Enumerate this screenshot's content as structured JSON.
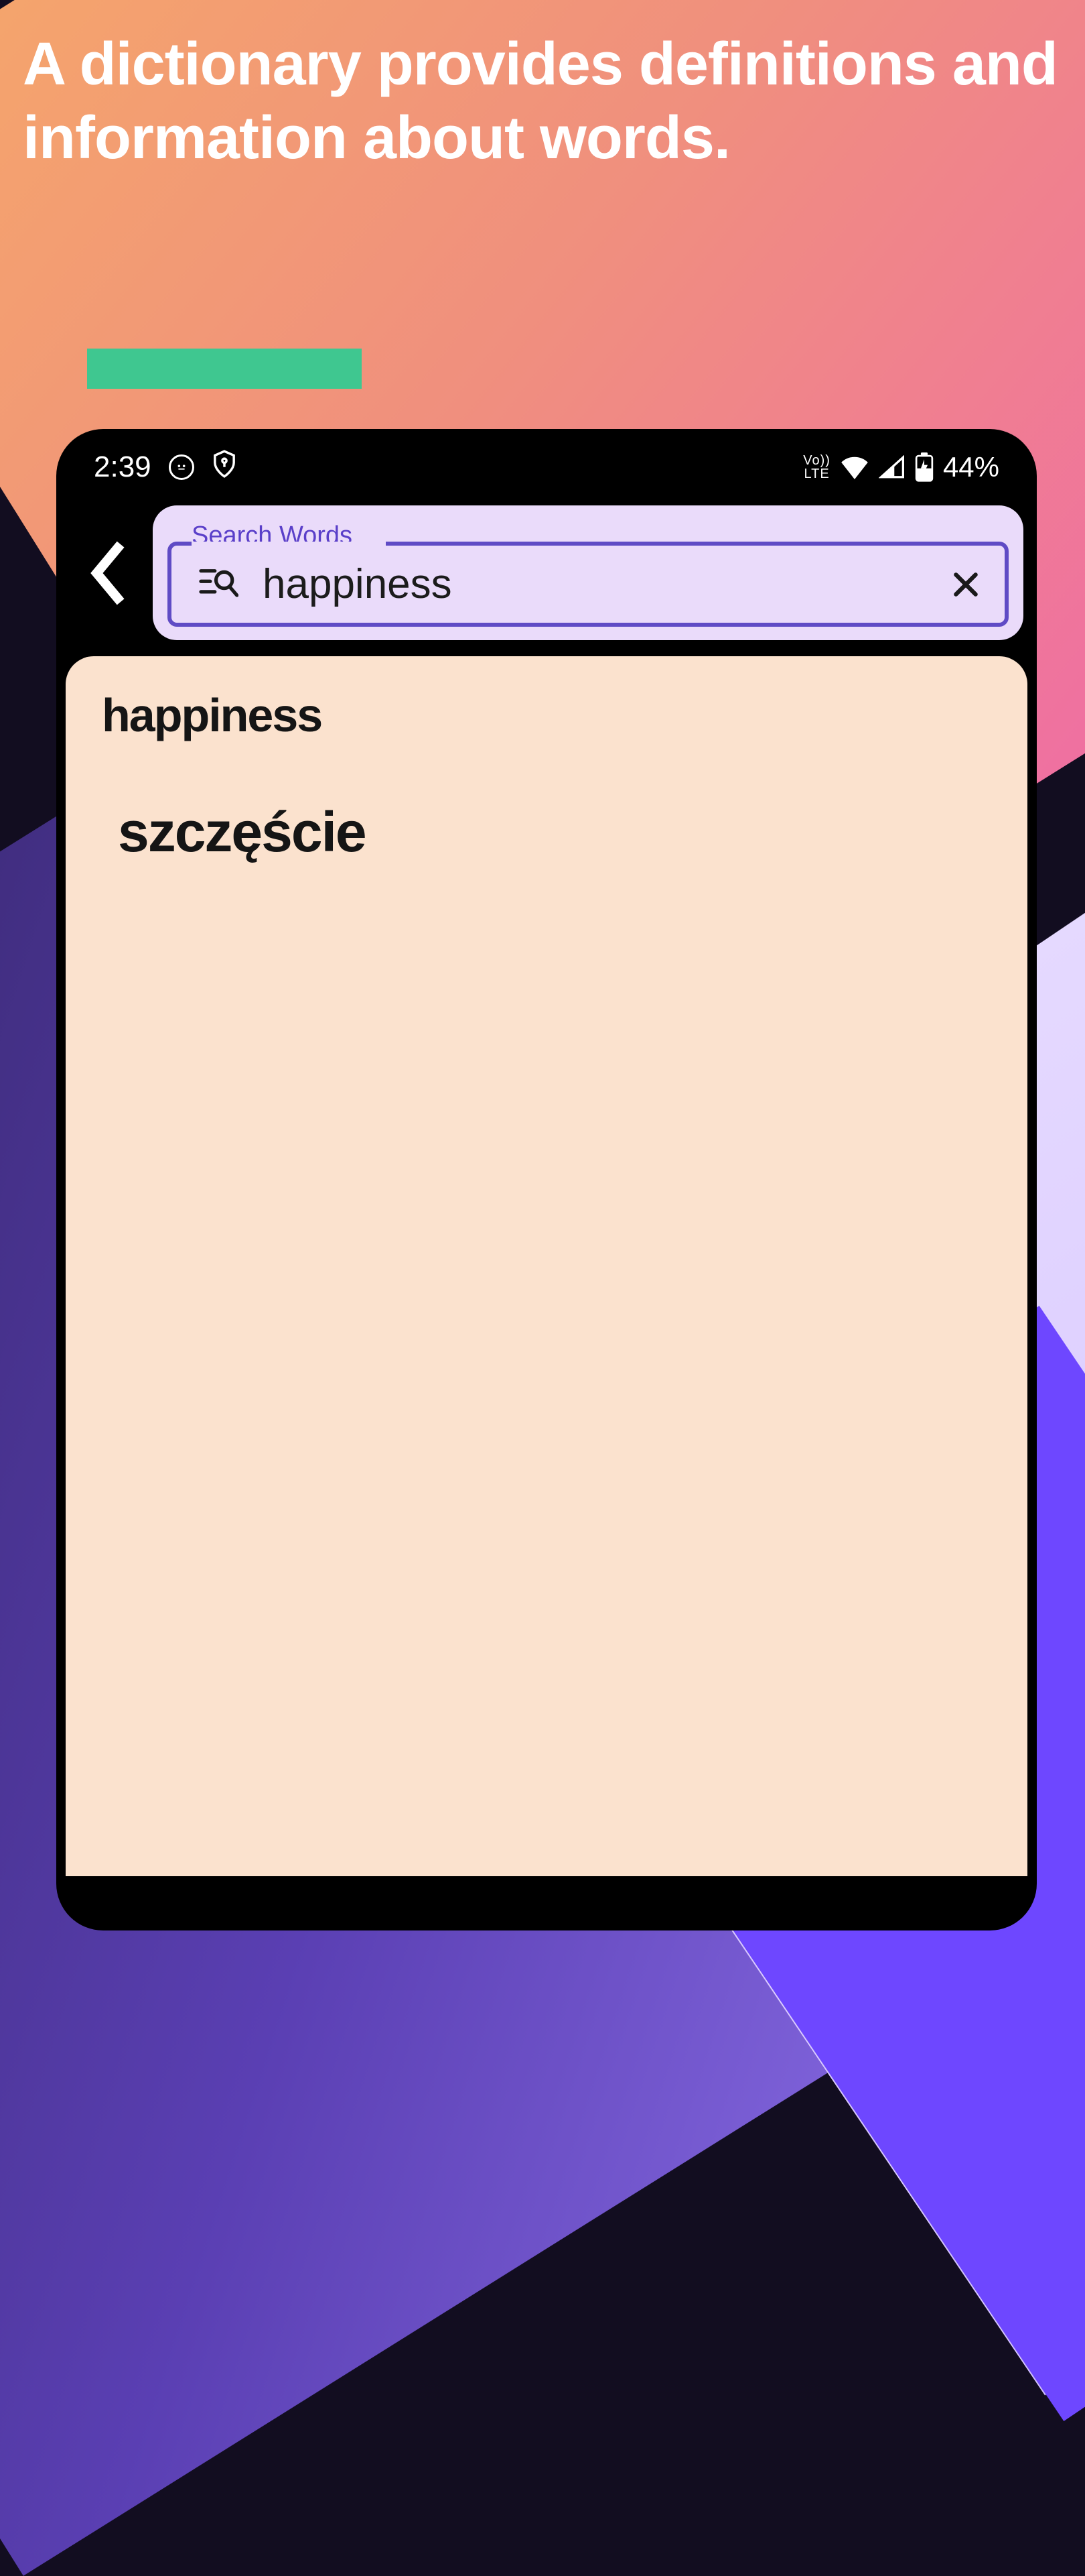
{
  "headline": "A dictionary provides definitions and information about words.",
  "statusbar": {
    "time": "2:39",
    "network_label": "Vo\nLTE",
    "battery_text": "44%"
  },
  "search": {
    "label": "Search Words",
    "value": "happiness"
  },
  "result": {
    "source": "happiness",
    "translation": "szczęście"
  }
}
